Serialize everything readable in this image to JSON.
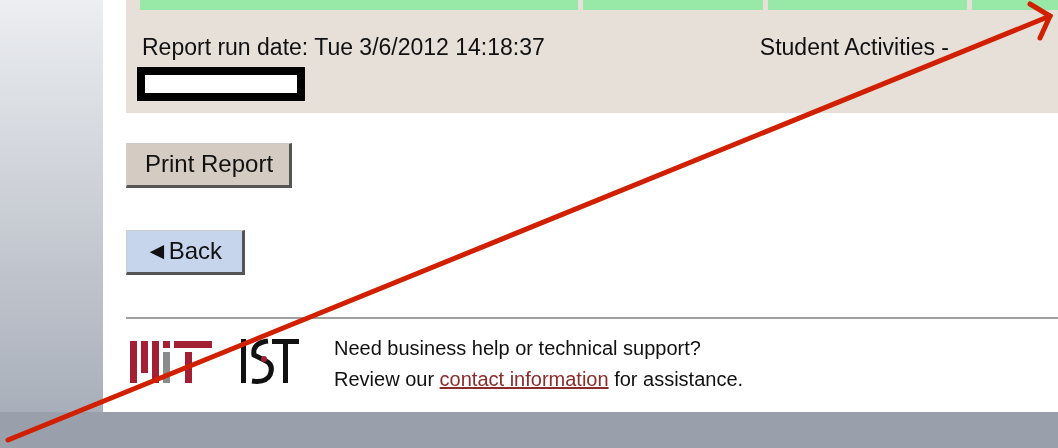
{
  "report_footer": {
    "run_date": "Report run date: Tue 3/6/2012 14:18:37",
    "report_name": "Student Activities -"
  },
  "buttons": [
    {
      "kind": "print",
      "label": "Print Report"
    },
    {
      "kind": "back",
      "label": "Back",
      "icon": "◄"
    }
  ],
  "site_footer": {
    "line_1": "Need business help or technical support?",
    "line_2_before": "Review our",
    "link": "contact information",
    "line_2_after": "for assistance."
  }
}
